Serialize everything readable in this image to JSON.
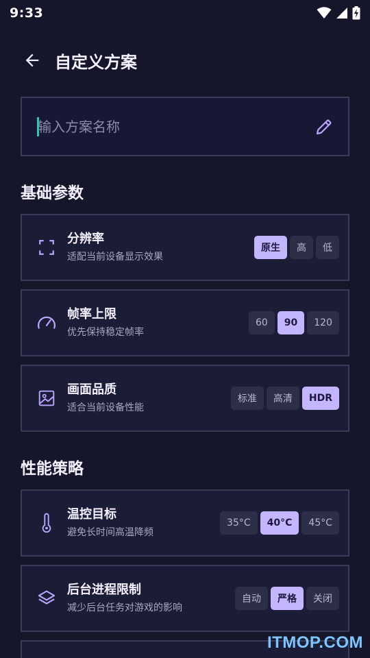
{
  "status_bar": {
    "time": "9:33"
  },
  "header": {
    "title": "自定义方案"
  },
  "name_field": {
    "placeholder": "输入方案名称"
  },
  "sections": {
    "basic": "基础参数",
    "performance": "性能策略"
  },
  "cards": {
    "resolution": {
      "title": "分辨率",
      "subtitle": "适配当前设备显示效果",
      "options": [
        "原生",
        "高",
        "低"
      ],
      "selected": "原生"
    },
    "fps": {
      "title": "帧率上限",
      "subtitle": "优先保持稳定帧率",
      "options": [
        "60",
        "90",
        "120"
      ],
      "selected": "90"
    },
    "quality": {
      "title": "画面品质",
      "subtitle": "适合当前设备性能",
      "options": [
        "标准",
        "高清",
        "HDR"
      ],
      "selected": "HDR"
    },
    "temperature": {
      "title": "温控目标",
      "subtitle": "避免长时间高温降频",
      "options": [
        "35°C",
        "40°C",
        "45°C"
      ],
      "selected": "40°C"
    },
    "background": {
      "title": "后台进程限制",
      "subtitle": "减少后台任务对游戏的影响",
      "options": [
        "自动",
        "严格",
        "关闭"
      ],
      "selected": "严格"
    }
  },
  "watermark": "ITMOP.COM",
  "colors": {
    "background": "#15162a",
    "accent": "#c4b5ff",
    "card": "#1b1c35",
    "border": "#3a3b58",
    "caret": "#28c7b8"
  }
}
